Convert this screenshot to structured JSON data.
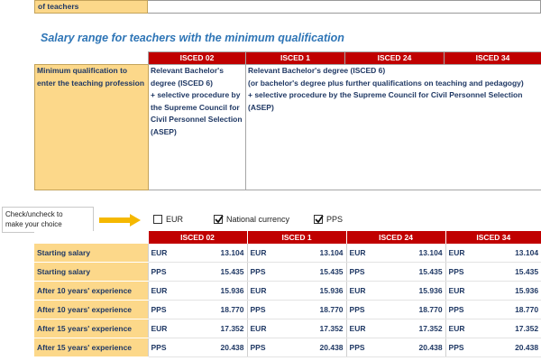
{
  "top_partial": {
    "label": "of teachers"
  },
  "section_title": "Salary range for teachers with the minimum qualification",
  "isced_headers": [
    "ISCED 02",
    "ISCED 1",
    "ISCED 24",
    "ISCED 34"
  ],
  "qualification": {
    "label_lines": [
      "Minimum qualification to",
      "enter the teaching profession"
    ],
    "isced02_lines": [
      "Relevant Bachelor's",
      "degree (ISCED 6)",
      "+ selective procedure by",
      "the Supreme Council for",
      "Civil Personnel Selection",
      "(ASEP)"
    ],
    "others_lines": [
      "Relevant Bachelor's degree (ISCED 6)",
      "(or bachelor's degree plus further qualifications on teaching and pedagogy)",
      "+ selective procedure by the Supreme Council for Civil Personnel Selection",
      "(ASEP)"
    ]
  },
  "hint": {
    "line1": "Check/uncheck to",
    "line2": "make your choice"
  },
  "checkboxes": [
    {
      "label": "EUR",
      "checked": false
    },
    {
      "label": "National currency",
      "checked": true
    },
    {
      "label": "PPS",
      "checked": true
    }
  ],
  "salary_rows": [
    {
      "label": "Starting salary",
      "currency": "EUR",
      "values": [
        "13.104",
        "13.104",
        "13.104",
        "13.104"
      ]
    },
    {
      "label": "Starting salary",
      "currency": "PPS",
      "values": [
        "15.435",
        "15.435",
        "15.435",
        "15.435"
      ]
    },
    {
      "label": "After 10 years' experience",
      "currency": "EUR",
      "values": [
        "15.936",
        "15.936",
        "15.936",
        "15.936"
      ]
    },
    {
      "label": "After 10 years' experience",
      "currency": "PPS",
      "values": [
        "18.770",
        "18.770",
        "18.770",
        "18.770"
      ]
    },
    {
      "label": "After 15 years' experience",
      "currency": "EUR",
      "values": [
        "17.352",
        "17.352",
        "17.352",
        "17.352"
      ]
    },
    {
      "label": "After 15 years' experience",
      "currency": "PPS",
      "values": [
        "20.438",
        "20.438",
        "20.438",
        "20.438"
      ]
    }
  ]
}
